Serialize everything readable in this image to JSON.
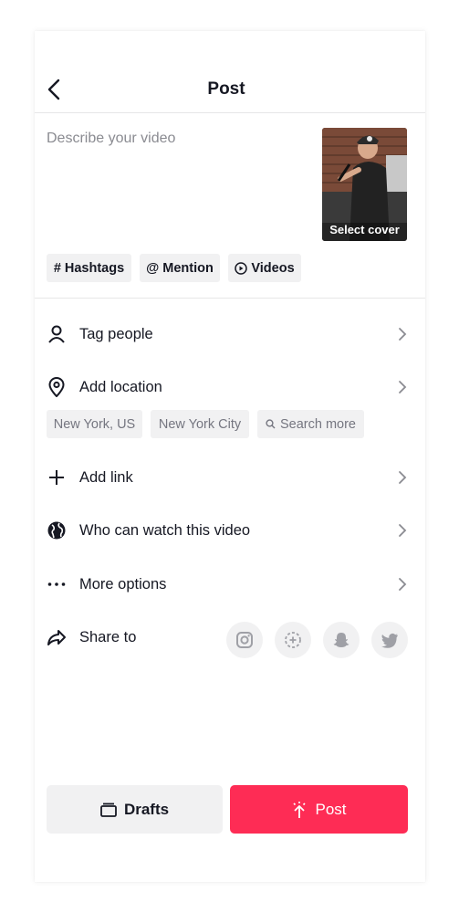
{
  "header": {
    "title": "Post"
  },
  "description": {
    "placeholder": "Describe your video"
  },
  "cover": {
    "label": "Select cover"
  },
  "chips": [
    {
      "icon": "hash-icon",
      "label": "Hashtags"
    },
    {
      "icon": "at-icon",
      "label": "Mention"
    },
    {
      "icon": "play-circle-icon",
      "label": "Videos"
    }
  ],
  "rows": {
    "tag_people": "Tag people",
    "add_location": "Add location",
    "add_link": "Add link",
    "who_can_watch": "Who can watch this video",
    "more_options": "More options",
    "share_to": "Share to"
  },
  "location_suggestions": [
    "New York, US",
    "New York City",
    "Search more"
  ],
  "share_targets": [
    "instagram-icon",
    "stories-add-icon",
    "snapchat-icon",
    "twitter-icon"
  ],
  "buttons": {
    "drafts": "Drafts",
    "post": "Post"
  },
  "colors": {
    "accent": "#fe2c55",
    "chip_bg": "#f1f1f2",
    "text": "#161823",
    "muted": "#8a8b91"
  }
}
